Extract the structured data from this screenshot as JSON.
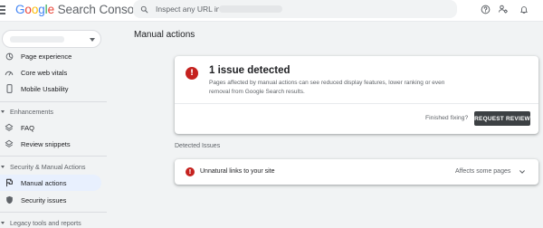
{
  "header": {
    "brand_google": "Google",
    "brand_product": "Search Console",
    "search_placeholder": "Inspect any URL in",
    "help_icon": "help-icon",
    "users_icon": "manage-users-icon",
    "notifications_icon": "bell-icon"
  },
  "sidebar": {
    "items": [
      {
        "label": "Page experience",
        "icon": "page-experience-icon"
      },
      {
        "label": "Core web vitals",
        "icon": "speedometer-icon"
      },
      {
        "label": "Mobile Usability",
        "icon": "phone-icon"
      }
    ],
    "enhancements_header": "Enhancements",
    "enhancements": [
      {
        "label": "FAQ",
        "icon": "layers-icon"
      },
      {
        "label": "Review snippets",
        "icon": "layers-icon"
      }
    ],
    "security_header": "Security & Manual Actions",
    "security": [
      {
        "label": "Manual actions",
        "icon": "flag-icon",
        "active": true
      },
      {
        "label": "Security issues",
        "icon": "shield-icon"
      }
    ],
    "legacy_header": "Legacy tools and reports"
  },
  "main": {
    "title": "Manual actions",
    "summary": {
      "title": "1 issue detected",
      "description": "Pages affected by manual actions can see reduced display features, lower ranking or even removal from Google Search results.",
      "finished_prompt": "Finished fixing?",
      "request_button": "REQUEST REVIEW"
    },
    "detected_label": "Detected Issues",
    "issues": [
      {
        "label": "Unnatural links to your site",
        "status": "Affects some pages"
      }
    ]
  },
  "colors": {
    "error": "#c5221f",
    "accent": "#1a73e8",
    "active_bg": "#e8f0fe",
    "button_dark": "#3c4043"
  }
}
